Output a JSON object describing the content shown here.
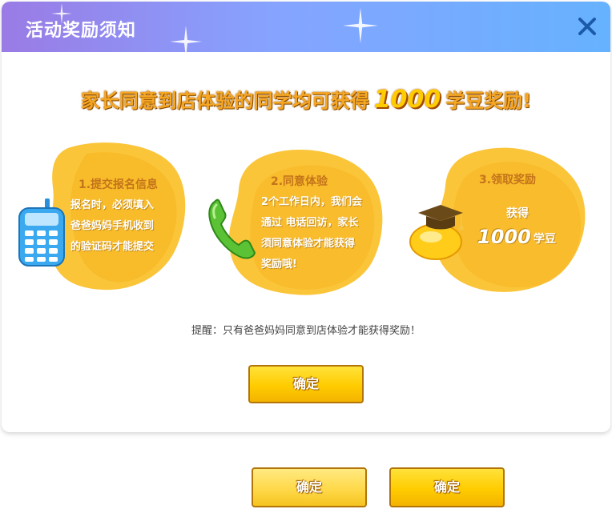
{
  "modal": {
    "title": "活动奖励须知",
    "close_icon": "close-icon",
    "headline": {
      "prefix": "家长同意到店体验的同学均可获得",
      "amount": "1000",
      "suffix": "学豆奖励!"
    },
    "steps": [
      {
        "title": "1.提交报名信息",
        "lines": [
          "报名时，必须填入",
          "爸爸妈妈手机收到",
          "的验证码才能提交"
        ],
        "icon": "mobile-phone-icon"
      },
      {
        "title": "2.同意体验",
        "lines": [
          "2个工作日内，我们会",
          "通过 电话回访，家长",
          "须同意体验才能获得",
          "奖励哦!"
        ],
        "icon": "telephone-handset-icon"
      },
      {
        "title": "3.领取奖励",
        "reward_label": "获得",
        "reward_amount": "1000",
        "reward_unit": "学豆",
        "icon": "gold-bean-graduation-cap-icon"
      }
    ],
    "reminder": "提醒：只有爸爸妈妈同意到店体验才能获得奖励！",
    "confirm_label": "确定"
  },
  "bottom_buttons": [
    {
      "label": "确定",
      "style": "light"
    },
    {
      "label": "确定",
      "style": "primary"
    }
  ],
  "colors": {
    "header_start": "#9a7be5",
    "header_end": "#66b2ff",
    "blob": "#fbc53a",
    "button": "#ffcc00",
    "headline": "#f5a623"
  }
}
